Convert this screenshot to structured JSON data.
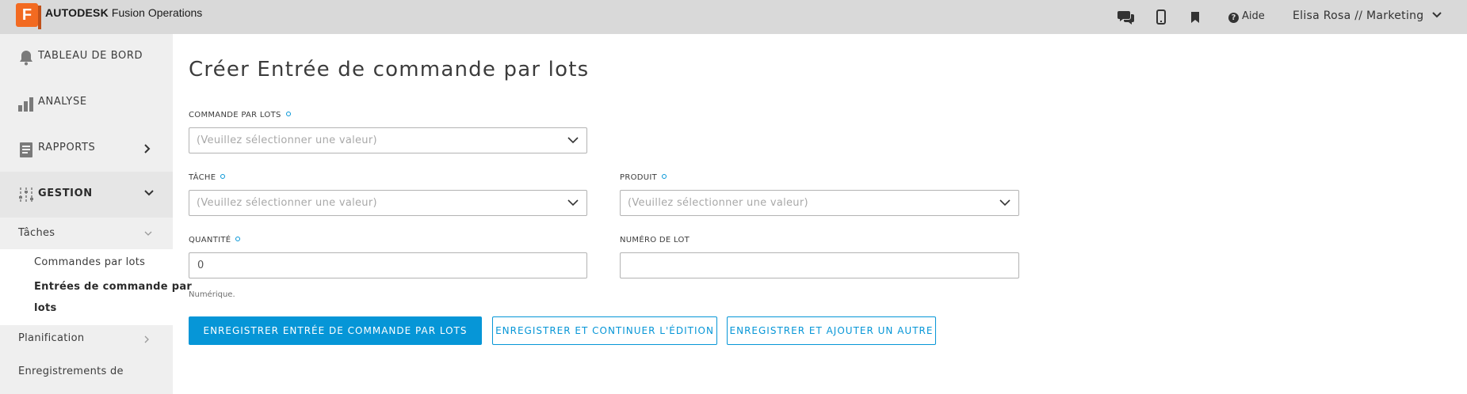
{
  "app": {
    "logo_letter": "F",
    "brand_bold": "AUTODESK",
    "brand_product": "Fusion Operations",
    "help_label": "Aide",
    "user_label": "Elisa Rosa // Marketing",
    "topbar_icons": [
      "chat-icon",
      "mobile-icon",
      "bookmark-icon",
      "help-icon"
    ]
  },
  "sidebar": {
    "items": [
      {
        "label": "TABLEAU DE BORD",
        "icon": "bell-icon"
      },
      {
        "label": "ANALYSE",
        "icon": "bar-chart-icon"
      },
      {
        "label": "RAPPORTS",
        "icon": "report-icon"
      },
      {
        "label": "GESTION",
        "icon": "sliders-icon"
      }
    ],
    "sub": {
      "taches": "Tâches",
      "commandes_par_lots": "Commandes par lots",
      "entrees_line1": "Entrées de commande par",
      "entrees_line2": "lots",
      "planification": "Planification",
      "enregistrements": "Enregistrements de"
    }
  },
  "form": {
    "title": "Créer Entrée de commande par lots",
    "commande": {
      "label": "COMMANDE PAR LOTS",
      "placeholder": "(Veuillez sélectionner une valeur)"
    },
    "tache": {
      "label": "TÂCHE",
      "placeholder": "(Veuillez sélectionner une valeur)"
    },
    "produit": {
      "label": "PRODUIT",
      "placeholder": "(Veuillez sélectionner une valeur)"
    },
    "quantite": {
      "label": "QUANTITÉ",
      "value": "0",
      "hint": "Numérique."
    },
    "numero_lot": {
      "label": "NUMÉRO DE LOT",
      "value": ""
    },
    "buttons": {
      "save": "ENREGISTRER ENTRÉE DE COMMANDE PAR LOTS",
      "save_continue": "ENREGISTRER ET CONTINUER L'ÉDITION",
      "save_add": "ENREGISTRER ET AJOUTER UN AUTRE"
    }
  },
  "colors": {
    "accent": "#0696d7",
    "brand_orange": "#f26a21",
    "topbar": "#d9d9d9",
    "sidebar": "#efefef"
  }
}
